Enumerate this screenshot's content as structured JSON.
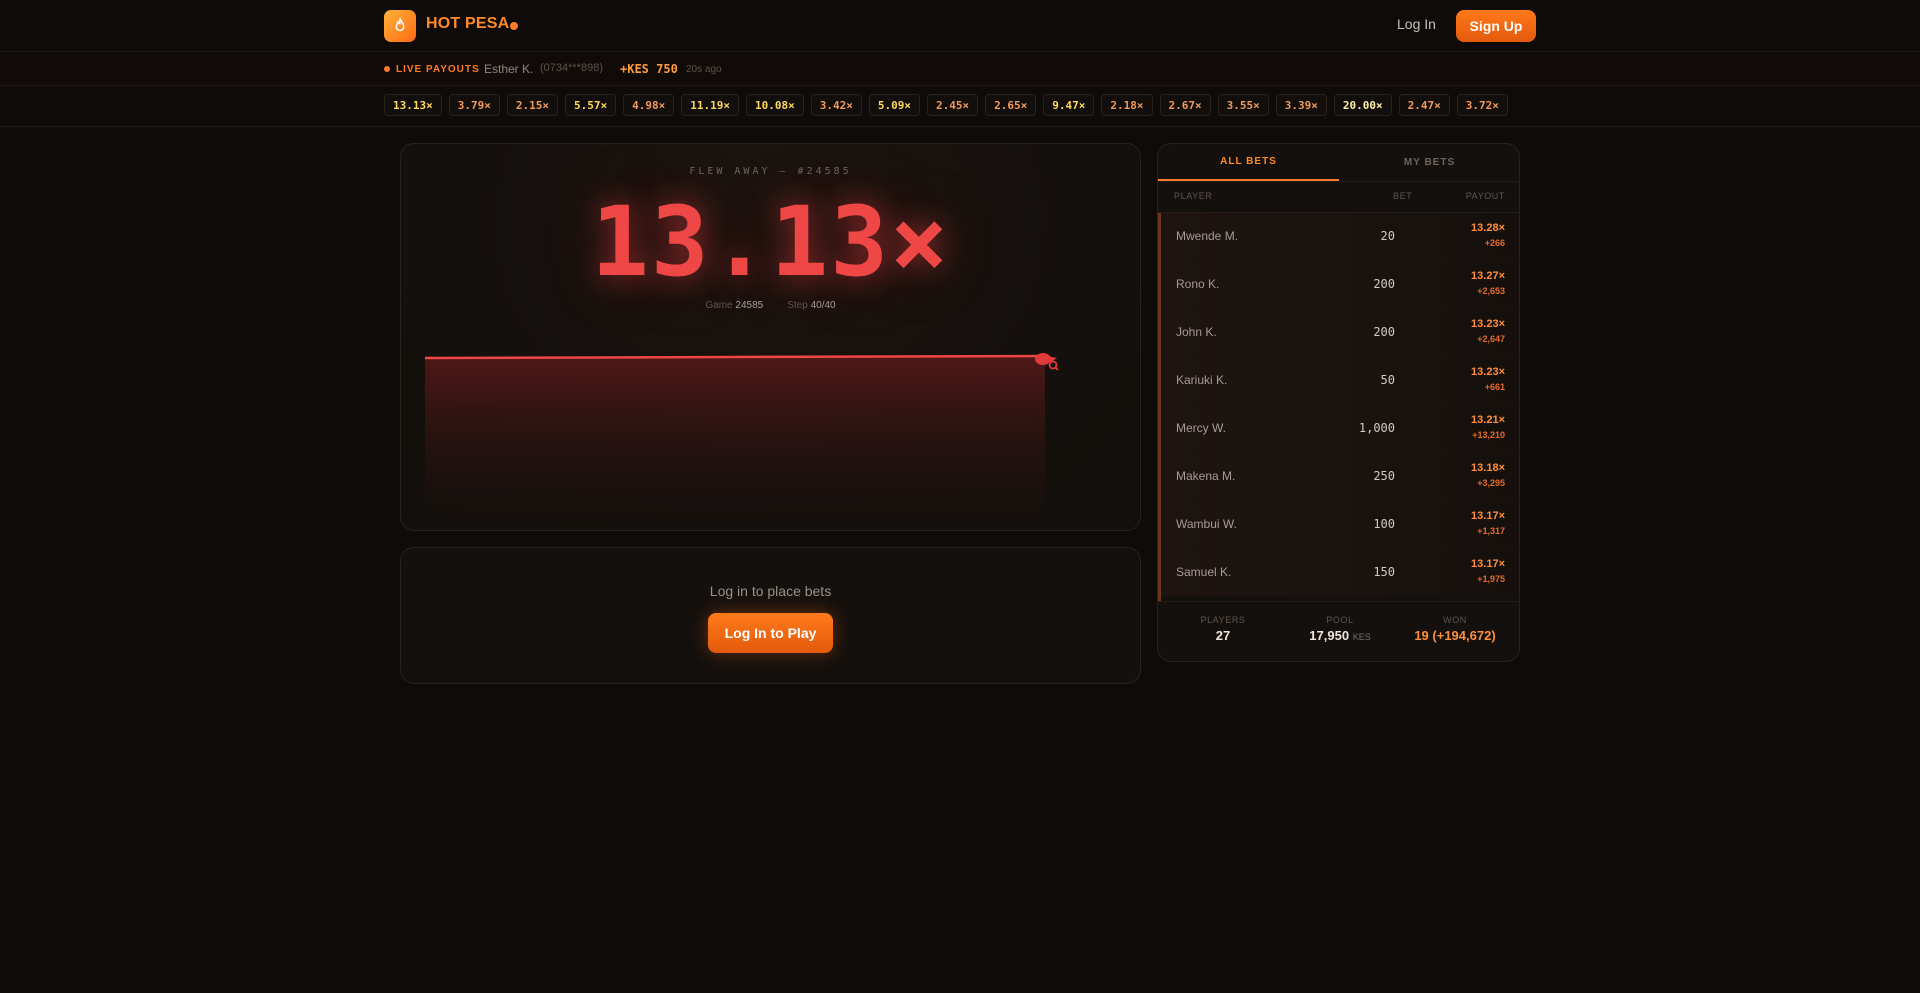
{
  "header": {
    "brand": "HOT PESA",
    "login_label": "Log In",
    "signup_label": "Sign Up",
    "accent_color": "#ff7a1a"
  },
  "ticker": {
    "label": "LIVE PAYOUTS",
    "name": "Esther K.",
    "phone": "(0734***898)",
    "amount": "+KES 750",
    "time": "20s ago"
  },
  "history": [
    {
      "value": "13.13×",
      "tier": "hi"
    },
    {
      "value": "3.79×",
      "tier": "lo"
    },
    {
      "value": "2.15×",
      "tier": "lo"
    },
    {
      "value": "5.57×",
      "tier": "hi"
    },
    {
      "value": "4.98×",
      "tier": "lo"
    },
    {
      "value": "11.19×",
      "tier": "hi"
    },
    {
      "value": "10.08×",
      "tier": "hi"
    },
    {
      "value": "3.42×",
      "tier": "lo"
    },
    {
      "value": "5.09×",
      "tier": "hi"
    },
    {
      "value": "2.45×",
      "tier": "lo"
    },
    {
      "value": "2.65×",
      "tier": "lo"
    },
    {
      "value": "9.47×",
      "tier": "hi"
    },
    {
      "value": "2.18×",
      "tier": "lo"
    },
    {
      "value": "2.67×",
      "tier": "lo"
    },
    {
      "value": "3.55×",
      "tier": "lo"
    },
    {
      "value": "3.39×",
      "tier": "lo"
    },
    {
      "value": "20.00×",
      "tier": "top"
    },
    {
      "value": "2.47×",
      "tier": "lo"
    },
    {
      "value": "3.72×",
      "tier": "lo"
    }
  ],
  "game": {
    "status": "FLEW AWAY — #24585",
    "multiplier": "13.13×",
    "game_label": "Game",
    "game_value": "24585",
    "step_label": "Step",
    "step_value": "40/40",
    "crash_color": "#ef4646",
    "icon": "rocket-icon"
  },
  "login_panel": {
    "prompt": "Log in to place bets",
    "button_label": "Log In to Play"
  },
  "bets": {
    "tab_all": "ALL BETS",
    "tab_my": "MY BETS",
    "col_player": "PLAYER",
    "col_bet": "BET",
    "col_payout": "PAYOUT",
    "rows": [
      {
        "player": "Mwende M.",
        "bet": "20",
        "mult": "13.28×",
        "win": "+266"
      },
      {
        "player": "Rono K.",
        "bet": "200",
        "mult": "13.27×",
        "win": "+2,653"
      },
      {
        "player": "John K.",
        "bet": "200",
        "mult": "13.23×",
        "win": "+2,647"
      },
      {
        "player": "Kariuki K.",
        "bet": "50",
        "mult": "13.23×",
        "win": "+661"
      },
      {
        "player": "Mercy W.",
        "bet": "1,000",
        "mult": "13.21×",
        "win": "+13,210"
      },
      {
        "player": "Makena M.",
        "bet": "250",
        "mult": "13.18×",
        "win": "+3,295"
      },
      {
        "player": "Wambui W.",
        "bet": "100",
        "mult": "13.17×",
        "win": "+1,317"
      },
      {
        "player": "Samuel K.",
        "bet": "150",
        "mult": "13.17×",
        "win": "+1,975"
      }
    ],
    "stats": {
      "players_label": "PLAYERS",
      "players_value": "27",
      "pool_label": "POOL",
      "pool_value": "17,950",
      "pool_unit": "KES",
      "won_label": "WON",
      "won_value": "19 (+194,672)"
    }
  }
}
